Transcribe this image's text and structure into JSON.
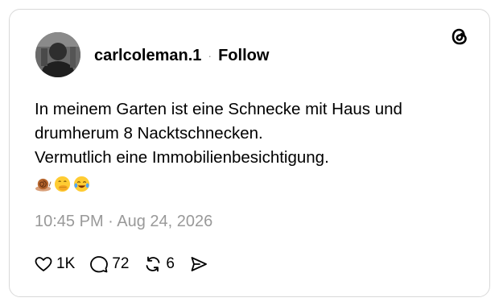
{
  "post": {
    "username": "carlcoleman.1",
    "separator": "·",
    "follow_label": "Follow",
    "text_lines": [
      "In meinem Garten ist eine Schnecke mit Haus und",
      "drumherum 8 Nacktschnecken.",
      "Vermutlich eine Immobilienbesichtigung."
    ],
    "emojis": [
      "snail-emoji",
      "hand-over-mouth-emoji",
      "tears-of-joy-emoji"
    ],
    "timestamp": "10:45 PM · Aug 24, 2026"
  },
  "actions": {
    "likes": "1K",
    "replies": "72",
    "reposts": "6"
  },
  "icons": {
    "brand": "threads-logo-icon",
    "like": "heart-icon",
    "reply": "comment-bubble-icon",
    "repost": "repost-icon",
    "share": "share-icon"
  },
  "colors": {
    "text": "#000000",
    "muted": "#999999",
    "border": "#d9d9d9"
  }
}
